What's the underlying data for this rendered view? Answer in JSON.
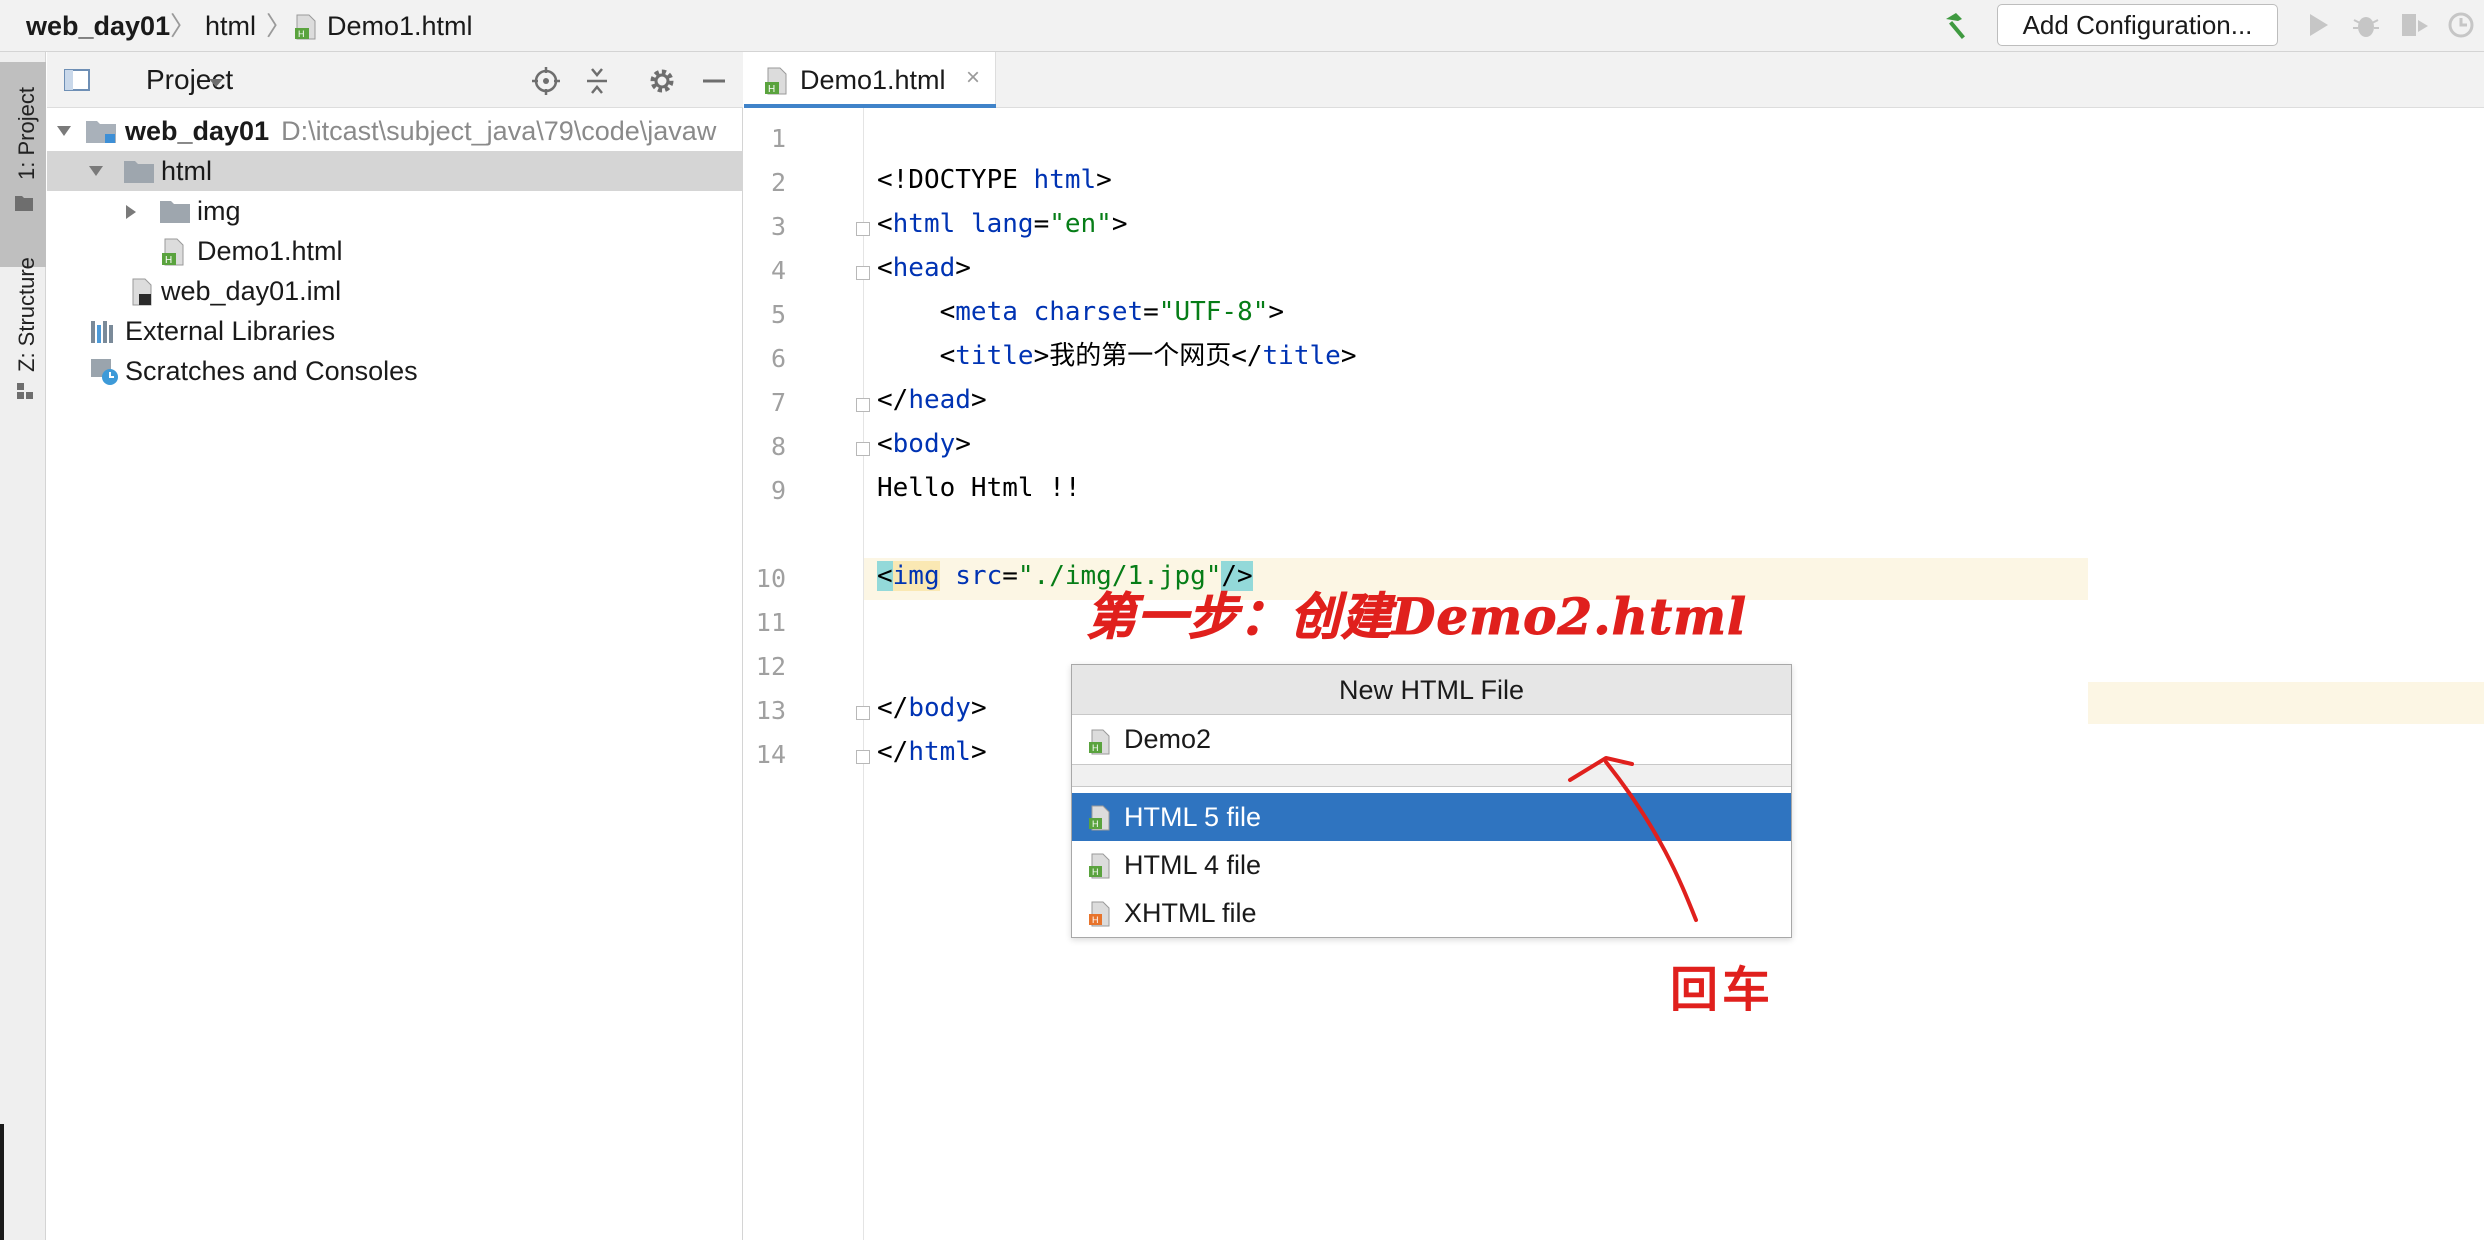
{
  "breadcrumb": {
    "project": "web_day01",
    "folder": "html",
    "file": "Demo1.html",
    "separator": "〉"
  },
  "toolbar": {
    "add_configuration_label": "Add Configuration...",
    "icons": [
      "hammer-icon",
      "run-icon",
      "debug-icon",
      "coverage-icon",
      "profile-icon"
    ]
  },
  "left_strip": {
    "project_tab": "1: Project",
    "structure_tab": "Z: Structure"
  },
  "project_panel": {
    "title": "Project",
    "tree": [
      {
        "label": "web_day01",
        "path": "D:\\itcast\\subject_java\\79\\code\\javaw",
        "icon": "module-folder-icon"
      },
      {
        "label": "html",
        "icon": "folder-icon"
      },
      {
        "label": "img",
        "icon": "folder-icon"
      },
      {
        "label": "Demo1.html",
        "icon": "html-file-icon"
      },
      {
        "label": "web_day01.iml",
        "icon": "iml-file-icon"
      },
      {
        "label": "External Libraries",
        "icon": "libraries-icon"
      },
      {
        "label": "Scratches and Consoles",
        "icon": "scratches-icon"
      }
    ]
  },
  "editor": {
    "tab_label": "Demo1.html",
    "tab_close": "×",
    "line_numbers": [
      "1",
      "2",
      "3",
      "4",
      "5",
      "6",
      "7",
      "8",
      "9",
      "10",
      "11",
      "12",
      "13",
      "14"
    ],
    "code": {
      "l1a": "<!DOCTYPE ",
      "l1b": "html",
      "l1c": ">",
      "l2a": "<",
      "l2b": "html ",
      "l2c": "lang",
      "l2d": "=",
      "l2e": "\"en\"",
      "l2f": ">",
      "l3a": "<",
      "l3b": "head",
      "l3c": ">",
      "l4a": "    <",
      "l4b": "meta ",
      "l4c": "charset",
      "l4d": "=",
      "l4e": "\"UTF-8\"",
      "l4f": ">",
      "l5a": "    <",
      "l5b": "title",
      "l5c": ">我的第一个网页</",
      "l5d": "title",
      "l5e": ">",
      "l6a": "</",
      "l6b": "head",
      "l6c": ">",
      "l7a": "<",
      "l7b": "body",
      "l7c": ">",
      "l8": "Hello Html !!",
      "l10a": "<",
      "l10b": "img",
      "l10c": " ",
      "l10d": "src",
      "l10e": "=",
      "l10f": "\"./img/1.jpg\"",
      "l10g": "/>",
      "l13a": "</",
      "l13b": "body",
      "l13c": ">",
      "l14a": "</",
      "l14b": "html",
      "l14c": ">"
    }
  },
  "popup": {
    "title": "New HTML File",
    "input_value": "Demo2",
    "items": [
      "HTML 5 file",
      "HTML 4 file",
      "XHTML file"
    ],
    "selected_index": 0
  },
  "annotations": {
    "step": "第一步：创建Demo2.html",
    "enter": "回车",
    "color": "#e0201d"
  },
  "colors": {
    "selection": "#2f74c0",
    "keyword": "#0033b3",
    "string": "#067d17",
    "current_line": "#fcf6e4"
  }
}
